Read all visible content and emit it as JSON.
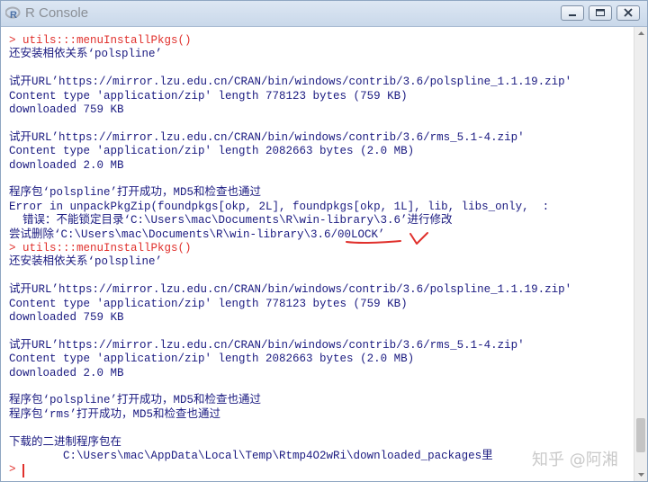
{
  "window": {
    "title": "R Console",
    "icon": "r-logo-icon",
    "controls": [
      "minimize-icon",
      "maximize-icon",
      "close-icon"
    ]
  },
  "console": {
    "lines": [
      {
        "text": "> utils:::menuInstallPkgs()",
        "kind": "cmd"
      },
      {
        "text": "还安装相依关系‘polspline’",
        "kind": "out"
      },
      {
        "text": "",
        "kind": "out"
      },
      {
        "text": "试开URL’https://mirror.lzu.edu.cn/CRAN/bin/windows/contrib/3.6/polspline_1.1.19.zip'",
        "kind": "out"
      },
      {
        "text": "Content type 'application/zip' length 778123 bytes (759 KB)",
        "kind": "out"
      },
      {
        "text": "downloaded 759 KB",
        "kind": "out"
      },
      {
        "text": "",
        "kind": "out"
      },
      {
        "text": "试开URL’https://mirror.lzu.edu.cn/CRAN/bin/windows/contrib/3.6/rms_5.1-4.zip'",
        "kind": "out"
      },
      {
        "text": "Content type 'application/zip' length 2082663 bytes (2.0 MB)",
        "kind": "out"
      },
      {
        "text": "downloaded 2.0 MB",
        "kind": "out"
      },
      {
        "text": "",
        "kind": "out"
      },
      {
        "text": "程序包‘polspline’打开成功，MD5和检查也通过",
        "kind": "out"
      },
      {
        "text": "Error in unpackPkgZip(foundpkgs[okp, 2L], foundpkgs[okp, 1L], lib, libs_only,  :",
        "kind": "out"
      },
      {
        "text": "  错误：不能锁定目录‘C:\\Users\\mac\\Documents\\R\\win-library\\3.6’进行修改",
        "kind": "out"
      },
      {
        "text": "尝试删除‘C:\\Users\\mac\\Documents\\R\\win-library\\3.6/00LOCK’",
        "kind": "out"
      },
      {
        "text": "> utils:::menuInstallPkgs()",
        "kind": "cmd"
      },
      {
        "text": "还安装相依关系‘polspline’",
        "kind": "out"
      },
      {
        "text": "",
        "kind": "out"
      },
      {
        "text": "试开URL’https://mirror.lzu.edu.cn/CRAN/bin/windows/contrib/3.6/polspline_1.1.19.zip'",
        "kind": "out"
      },
      {
        "text": "Content type 'application/zip' length 778123 bytes (759 KB)",
        "kind": "out"
      },
      {
        "text": "downloaded 759 KB",
        "kind": "out"
      },
      {
        "text": "",
        "kind": "out"
      },
      {
        "text": "试开URL’https://mirror.lzu.edu.cn/CRAN/bin/windows/contrib/3.6/rms_5.1-4.zip'",
        "kind": "out"
      },
      {
        "text": "Content type 'application/zip' length 2082663 bytes (2.0 MB)",
        "kind": "out"
      },
      {
        "text": "downloaded 2.0 MB",
        "kind": "out"
      },
      {
        "text": "",
        "kind": "out"
      },
      {
        "text": "程序包‘polspline’打开成功，MD5和检查也通过",
        "kind": "out"
      },
      {
        "text": "程序包‘rms’打开成功，MD5和检查也通过",
        "kind": "out"
      },
      {
        "text": "",
        "kind": "out"
      },
      {
        "text": "下载的二进制程序包在",
        "kind": "out"
      },
      {
        "text": "        C:\\Users\\mac\\AppData\\Local\\Temp\\Rtmp4O2wRi\\downloaded_packages里",
        "kind": "out"
      },
      {
        "text": "> ",
        "kind": "cmd"
      }
    ],
    "prompt": ">"
  },
  "scrollbar": {
    "position_fraction": 0.96,
    "thumb_fraction": 0.08
  },
  "annotation": {
    "color": "#e0302c",
    "marks": [
      "underline-mark",
      "check-mark"
    ]
  },
  "watermark": "知乎 @阿湘",
  "colors": {
    "output": "#1a1a80",
    "command": "#e0302c",
    "title_text": "#8a8f96"
  }
}
